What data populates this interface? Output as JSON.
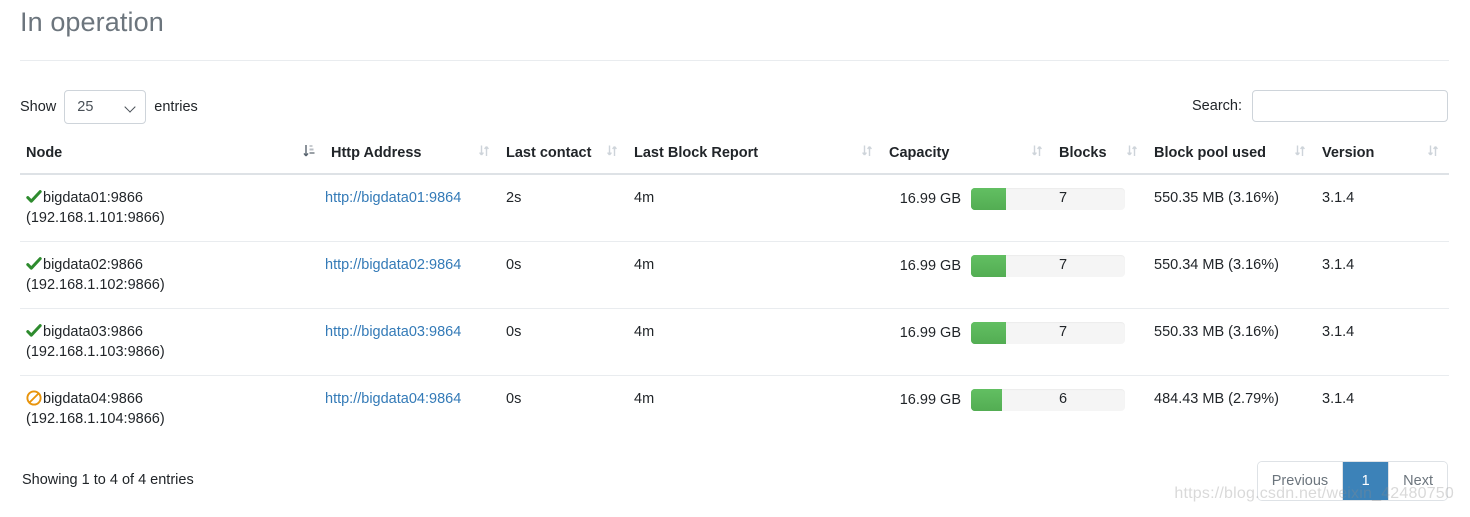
{
  "page": {
    "title": "In operation"
  },
  "controls": {
    "length_label_prefix": "Show",
    "length_label_suffix": "entries",
    "length_value": "25",
    "length_options": [
      "25"
    ],
    "search_label": "Search:",
    "search_value": "",
    "search_placeholder": ""
  },
  "table": {
    "columns": [
      {
        "label": "Node",
        "sort": "asc"
      },
      {
        "label": "Http Address",
        "sort": "none"
      },
      {
        "label": "Last contact",
        "sort": "none"
      },
      {
        "label": "Last Block Report",
        "sort": "none"
      },
      {
        "label": "Capacity",
        "sort": "none"
      },
      {
        "label": "Blocks",
        "sort": "none"
      },
      {
        "label": "Block pool used",
        "sort": "none"
      },
      {
        "label": "Version",
        "sort": "none"
      }
    ],
    "rows": [
      {
        "status_icon": "check-icon",
        "status_color": "#2e8b2e",
        "node": "bigdata01:9866",
        "node_address": "(192.168.1.101:9866)",
        "http_address": "http://bigdata01:9864",
        "last_contact": "2s",
        "last_block_report": "4m",
        "capacity": "16.99 GB",
        "capacity_used_percent": 23,
        "blocks": "7",
        "block_pool_used": "550.35 MB (3.16%)",
        "version": "3.1.4"
      },
      {
        "status_icon": "check-icon",
        "status_color": "#2e8b2e",
        "node": "bigdata02:9866",
        "node_address": "(192.168.1.102:9866)",
        "http_address": "http://bigdata02:9864",
        "last_contact": "0s",
        "last_block_report": "4m",
        "capacity": "16.99 GB",
        "capacity_used_percent": 23,
        "blocks": "7",
        "block_pool_used": "550.34 MB (3.16%)",
        "version": "3.1.4"
      },
      {
        "status_icon": "check-icon",
        "status_color": "#2e8b2e",
        "node": "bigdata03:9866",
        "node_address": "(192.168.1.103:9866)",
        "http_address": "http://bigdata03:9864",
        "last_contact": "0s",
        "last_block_report": "4m",
        "capacity": "16.99 GB",
        "capacity_used_percent": 23,
        "blocks": "7",
        "block_pool_used": "550.33 MB (3.16%)",
        "version": "3.1.4"
      },
      {
        "status_icon": "ban-icon",
        "status_color": "#e8940c",
        "node": "bigdata04:9866",
        "node_address": "(192.168.1.104:9866)",
        "http_address": "http://bigdata04:9864",
        "last_contact": "0s",
        "last_block_report": "4m",
        "capacity": "16.99 GB",
        "capacity_used_percent": 20,
        "blocks": "6",
        "block_pool_used": "484.43 MB (2.79%)",
        "version": "3.1.4"
      }
    ]
  },
  "footer": {
    "info": "Showing 1 to 4 of 4 entries",
    "previous_label": "Previous",
    "page_label": "1",
    "next_label": "Next"
  },
  "watermark": {
    "text": "https://blog.csdn.net/weixin_42480750"
  },
  "colors": {
    "accent": "#3c82b8",
    "link": "#337ab7",
    "bar_fill": "#5cb85c",
    "bar_track": "#f5f5f5",
    "status_ok": "#2e8b2e",
    "status_decommission": "#e8940c",
    "title": "#6c757d"
  }
}
